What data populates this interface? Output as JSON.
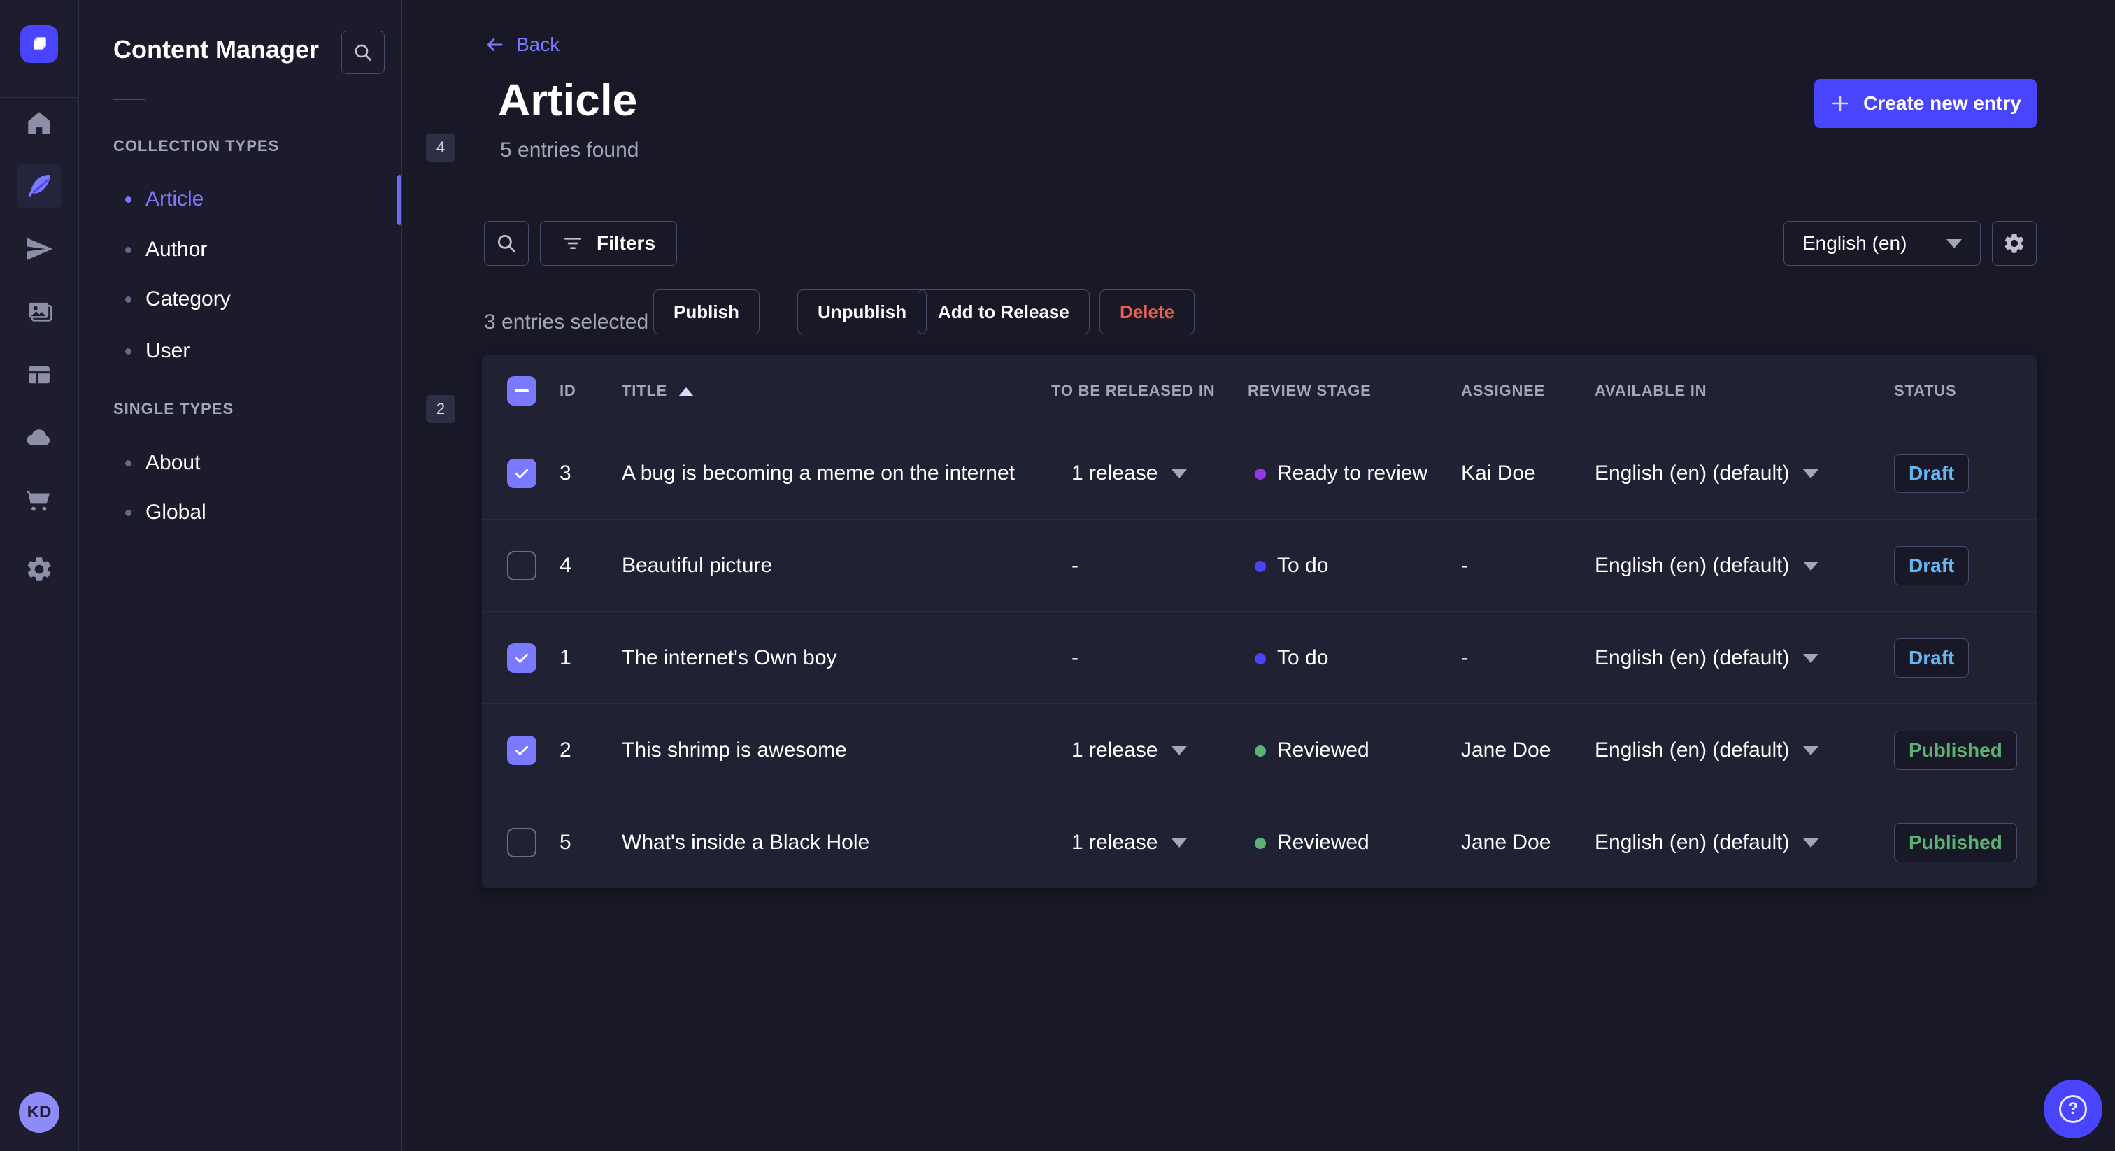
{
  "colors": {
    "primary": "#4945ff",
    "primary_light": "#7b79ff",
    "success": "#5cb176",
    "danger": "#ee5e52",
    "draft": "#66b7f1"
  },
  "left_nav": {
    "avatar": "KD"
  },
  "sidebar": {
    "title": "Content Manager",
    "sections": [
      {
        "label": "COLLECTION TYPES",
        "badge": "4",
        "items": [
          {
            "label": "Article"
          },
          {
            "label": "Author"
          },
          {
            "label": "Category"
          },
          {
            "label": "User"
          }
        ]
      },
      {
        "label": "SINGLE TYPES",
        "badge": "2",
        "items": [
          {
            "label": "About"
          },
          {
            "label": "Global"
          }
        ]
      }
    ]
  },
  "header": {
    "back_label": "Back",
    "title": "Article",
    "subtitle": "5 entries found",
    "create_button": "Create new entry"
  },
  "toolbar": {
    "filters_label": "Filters",
    "locale_value": "English (en)"
  },
  "selection": {
    "label": "3 entries selected",
    "publish": "Publish",
    "unpublish": "Unpublish",
    "add_to_release": "Add to Release",
    "delete": "Delete"
  },
  "table": {
    "headers": {
      "id": "ID",
      "title": "TITLE",
      "release": "TO BE RELEASED IN",
      "stage": "REVIEW STAGE",
      "assignee": "ASSIGNEE",
      "available": "AVAILABLE IN",
      "status": "STATUS"
    },
    "rows": [
      {
        "checked": true,
        "id": "3",
        "title": "A bug is becoming a meme on the internet",
        "release": "1 release",
        "stage": "Ready to review",
        "stage_color": "#9736e8",
        "assignee": "Kai Doe",
        "available": "English (en) (default)",
        "status": "Draft",
        "status_color": "#66b7f1"
      },
      {
        "checked": false,
        "id": "4",
        "title": "Beautiful picture",
        "release": "-",
        "stage": "To do",
        "stage_color": "#4945ff",
        "assignee": "-",
        "available": "English (en) (default)",
        "status": "Draft",
        "status_color": "#66b7f1"
      },
      {
        "checked": true,
        "id": "1",
        "title": "The internet's Own boy",
        "release": "-",
        "stage": "To do",
        "stage_color": "#4945ff",
        "assignee": "-",
        "available": "English (en) (default)",
        "status": "Draft",
        "status_color": "#66b7f1"
      },
      {
        "checked": true,
        "id": "2",
        "title": "This shrimp is awesome",
        "release": "1 release",
        "stage": "Reviewed",
        "stage_color": "#5cb176",
        "assignee": "Jane Doe",
        "available": "English (en) (default)",
        "status": "Published",
        "status_color": "#5cb176"
      },
      {
        "checked": false,
        "id": "5",
        "title": "What's inside a Black Hole",
        "release": "1 release",
        "stage": "Reviewed",
        "stage_color": "#5cb176",
        "assignee": "Jane Doe",
        "available": "English (en) (default)",
        "status": "Published",
        "status_color": "#5cb176"
      }
    ]
  },
  "help": {
    "label": "?"
  }
}
